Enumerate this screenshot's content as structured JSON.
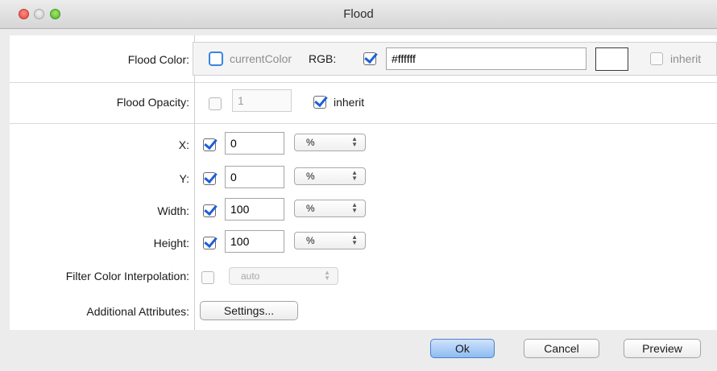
{
  "window": {
    "title": "Flood"
  },
  "flood_color": {
    "label": "Flood Color:",
    "current_color_label": "currentColor",
    "rgb_label": "RGB:",
    "rgb_value": "#ffffff",
    "swatch_color": "#ffffff",
    "inherit_label": "inherit"
  },
  "flood_opacity": {
    "label": "Flood Opacity:",
    "value": "1",
    "inherit_label": "inherit"
  },
  "fields": {
    "x": {
      "label": "X:",
      "value": "0",
      "unit": "%"
    },
    "y": {
      "label": "Y:",
      "value": "0",
      "unit": "%"
    },
    "width": {
      "label": "Width:",
      "value": "100",
      "unit": "%"
    },
    "height": {
      "label": "Height:",
      "value": "100",
      "unit": "%"
    }
  },
  "filter_color_interpolation": {
    "label": "Filter Color Interpolation:",
    "value": "auto"
  },
  "additional_attributes": {
    "label": "Additional Attributes:",
    "button_label": "Settings..."
  },
  "buttons": {
    "ok": "Ok",
    "cancel": "Cancel",
    "preview": "Preview"
  },
  "colors": {
    "accent": "#1e5fd6",
    "default_button": "#8ebcf2"
  }
}
